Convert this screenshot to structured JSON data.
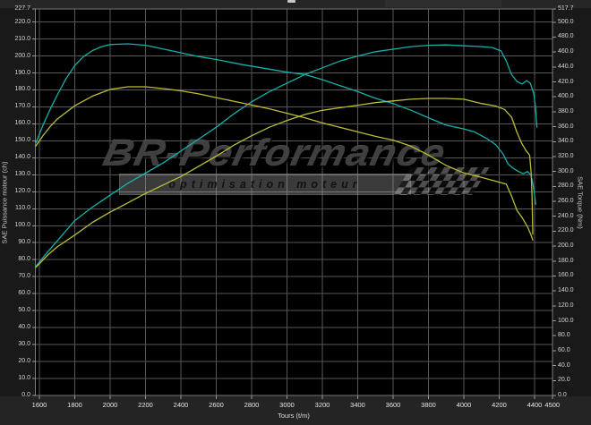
{
  "axes": {
    "left": {
      "title": "SAE Puissance moteur (ch)",
      "ticks": [
        "227.7",
        "220.0",
        "210.0",
        "200.0",
        "190.0",
        "180.0",
        "170.0",
        "160.0",
        "150.0",
        "140.0",
        "130.0",
        "120.0",
        "110.0",
        "100.0",
        "90.0",
        "80.0",
        "70.0",
        "60.0",
        "50.0",
        "40.0",
        "30.0",
        "20.0",
        "10.0",
        "0.0"
      ]
    },
    "right": {
      "title": "SAE Torque (Nm)",
      "ticks": [
        "517.7",
        "500.0",
        "480.0",
        "460.0",
        "440.0",
        "420.0",
        "400.0",
        "380.0",
        "360.0",
        "340.0",
        "320.0",
        "300.0",
        "280.0",
        "260.0",
        "240.0",
        "220.0",
        "200.0",
        "180.0",
        "160.0",
        "140.0",
        "120.0",
        "100.0",
        "80.0",
        "60.0",
        "40.0",
        "20.0",
        "0.0"
      ]
    },
    "x": {
      "title": "Tours (t/m)",
      "ticks": [
        "1600",
        "1800",
        "2000",
        "2200",
        "2400",
        "2600",
        "2800",
        "3000",
        "3200",
        "3400",
        "3600",
        "3800",
        "4000",
        "4200",
        "4400",
        "4500"
      ]
    }
  },
  "watermark": {
    "brand": "BR-Performance",
    "tagline": "optimisation moteur"
  },
  "colors": {
    "cyan_curve": "#17b0aa",
    "yellow_curve": "#bdbd35",
    "plot_bg": "#000000",
    "grid": "#575757",
    "border": "#7d7d7d",
    "outer_bg": "#191919"
  },
  "chart_data": {
    "type": "line",
    "title": "",
    "xlabel": "Tours (t/m)",
    "x_range": [
      1600,
      4500
    ],
    "x_tick_step": 200,
    "y_left": {
      "label": "SAE Puissance moteur (ch)",
      "range": [
        0,
        227.7
      ],
      "tick_step": 10
    },
    "y_right": {
      "label": "SAE Torque (Nm)",
      "range": [
        0,
        517.7
      ],
      "tick_step": 20
    },
    "grid": true,
    "legend": "none",
    "series": [
      {
        "name": "cyan-torque",
        "axis": "right",
        "color": "#17b0aa",
        "points": [
          [
            1580,
            338
          ],
          [
            1620,
            362
          ],
          [
            1660,
            383
          ],
          [
            1700,
            402
          ],
          [
            1750,
            424
          ],
          [
            1800,
            442
          ],
          [
            1850,
            454
          ],
          [
            1900,
            462
          ],
          [
            1950,
            467
          ],
          [
            2000,
            470
          ],
          [
            2100,
            471
          ],
          [
            2200,
            469
          ],
          [
            2300,
            464
          ],
          [
            2400,
            459
          ],
          [
            2500,
            454
          ],
          [
            2600,
            450
          ],
          [
            2750,
            443
          ],
          [
            2900,
            437
          ],
          [
            3000,
            433
          ],
          [
            3100,
            430
          ],
          [
            3200,
            423
          ],
          [
            3300,
            415
          ],
          [
            3400,
            407
          ],
          [
            3500,
            398
          ],
          [
            3600,
            391
          ],
          [
            3700,
            382
          ],
          [
            3800,
            372
          ],
          [
            3900,
            362
          ],
          [
            4000,
            357
          ],
          [
            4060,
            353
          ],
          [
            4130,
            344
          ],
          [
            4180,
            336
          ],
          [
            4220,
            324
          ],
          [
            4250,
            310
          ],
          [
            4280,
            304
          ],
          [
            4310,
            300
          ],
          [
            4335,
            297
          ],
          [
            4360,
            300
          ],
          [
            4380,
            295
          ],
          [
            4392,
            282
          ],
          [
            4400,
            268
          ],
          [
            4406,
            256
          ]
        ]
      },
      {
        "name": "cyan-power",
        "axis": "left",
        "color": "#17b0aa",
        "points": [
          [
            1580,
            76
          ],
          [
            1650,
            85
          ],
          [
            1700,
            91
          ],
          [
            1750,
            97
          ],
          [
            1800,
            103
          ],
          [
            1900,
            111
          ],
          [
            2000,
            118
          ],
          [
            2100,
            125
          ],
          [
            2200,
            131
          ],
          [
            2300,
            137
          ],
          [
            2400,
            144
          ],
          [
            2500,
            151
          ],
          [
            2600,
            158
          ],
          [
            2700,
            166
          ],
          [
            2800,
            173
          ],
          [
            2900,
            179
          ],
          [
            3000,
            184
          ],
          [
            3100,
            189
          ],
          [
            3200,
            193
          ],
          [
            3300,
            197
          ],
          [
            3400,
            200
          ],
          [
            3500,
            202.5
          ],
          [
            3600,
            204
          ],
          [
            3700,
            205.5
          ],
          [
            3800,
            206.3
          ],
          [
            3900,
            206.5
          ],
          [
            4000,
            206
          ],
          [
            4100,
            205.5
          ],
          [
            4160,
            205
          ],
          [
            4210,
            203
          ],
          [
            4240,
            197
          ],
          [
            4270,
            189
          ],
          [
            4300,
            185
          ],
          [
            4330,
            183.5
          ],
          [
            4355,
            185.5
          ],
          [
            4375,
            184
          ],
          [
            4395,
            178
          ],
          [
            4405,
            170
          ],
          [
            4413,
            158
          ]
        ]
      },
      {
        "name": "yellow-torque",
        "axis": "right",
        "color": "#bdbd35",
        "points": [
          [
            1580,
            334
          ],
          [
            1620,
            348
          ],
          [
            1660,
            360
          ],
          [
            1700,
            370
          ],
          [
            1800,
            388
          ],
          [
            1900,
            401
          ],
          [
            2000,
            410
          ],
          [
            2100,
            413.5
          ],
          [
            2200,
            413.5
          ],
          [
            2300,
            411
          ],
          [
            2400,
            408
          ],
          [
            2500,
            404
          ],
          [
            2600,
            399
          ],
          [
            2700,
            394
          ],
          [
            2800,
            389
          ],
          [
            2900,
            384
          ],
          [
            3000,
            378
          ],
          [
            3100,
            372
          ],
          [
            3200,
            365
          ],
          [
            3300,
            359
          ],
          [
            3400,
            353
          ],
          [
            3500,
            347
          ],
          [
            3600,
            342
          ],
          [
            3700,
            334
          ],
          [
            3800,
            322
          ],
          [
            3900,
            308
          ],
          [
            4000,
            298
          ],
          [
            4100,
            292
          ],
          [
            4180,
            287
          ],
          [
            4240,
            283
          ],
          [
            4270,
            267
          ],
          [
            4300,
            248
          ],
          [
            4330,
            238
          ],
          [
            4360,
            226
          ],
          [
            4378,
            216
          ],
          [
            4390,
            208
          ]
        ]
      },
      {
        "name": "yellow-power",
        "axis": "left",
        "color": "#bdbd35",
        "points": [
          [
            1580,
            75.5
          ],
          [
            1650,
            83
          ],
          [
            1700,
            87.5
          ],
          [
            1800,
            94.5
          ],
          [
            1900,
            102
          ],
          [
            2000,
            108
          ],
          [
            2100,
            113.5
          ],
          [
            2200,
            119
          ],
          [
            2300,
            124
          ],
          [
            2400,
            129
          ],
          [
            2500,
            135
          ],
          [
            2600,
            141
          ],
          [
            2700,
            147.5
          ],
          [
            2800,
            153
          ],
          [
            2900,
            158
          ],
          [
            3000,
            162
          ],
          [
            3100,
            165.5
          ],
          [
            3200,
            168
          ],
          [
            3300,
            169.5
          ],
          [
            3400,
            171
          ],
          [
            3500,
            172.5
          ],
          [
            3600,
            173.5
          ],
          [
            3700,
            174.5
          ],
          [
            3800,
            175
          ],
          [
            3900,
            175
          ],
          [
            4000,
            174.5
          ],
          [
            4100,
            172
          ],
          [
            4180,
            170.5
          ],
          [
            4230,
            168.5
          ],
          [
            4270,
            164
          ],
          [
            4300,
            155
          ],
          [
            4325,
            149
          ],
          [
            4350,
            144.5
          ],
          [
            4372,
            141.5
          ],
          [
            4381,
            131
          ],
          [
            4386,
            117
          ],
          [
            4390,
            95
          ]
        ]
      }
    ]
  }
}
